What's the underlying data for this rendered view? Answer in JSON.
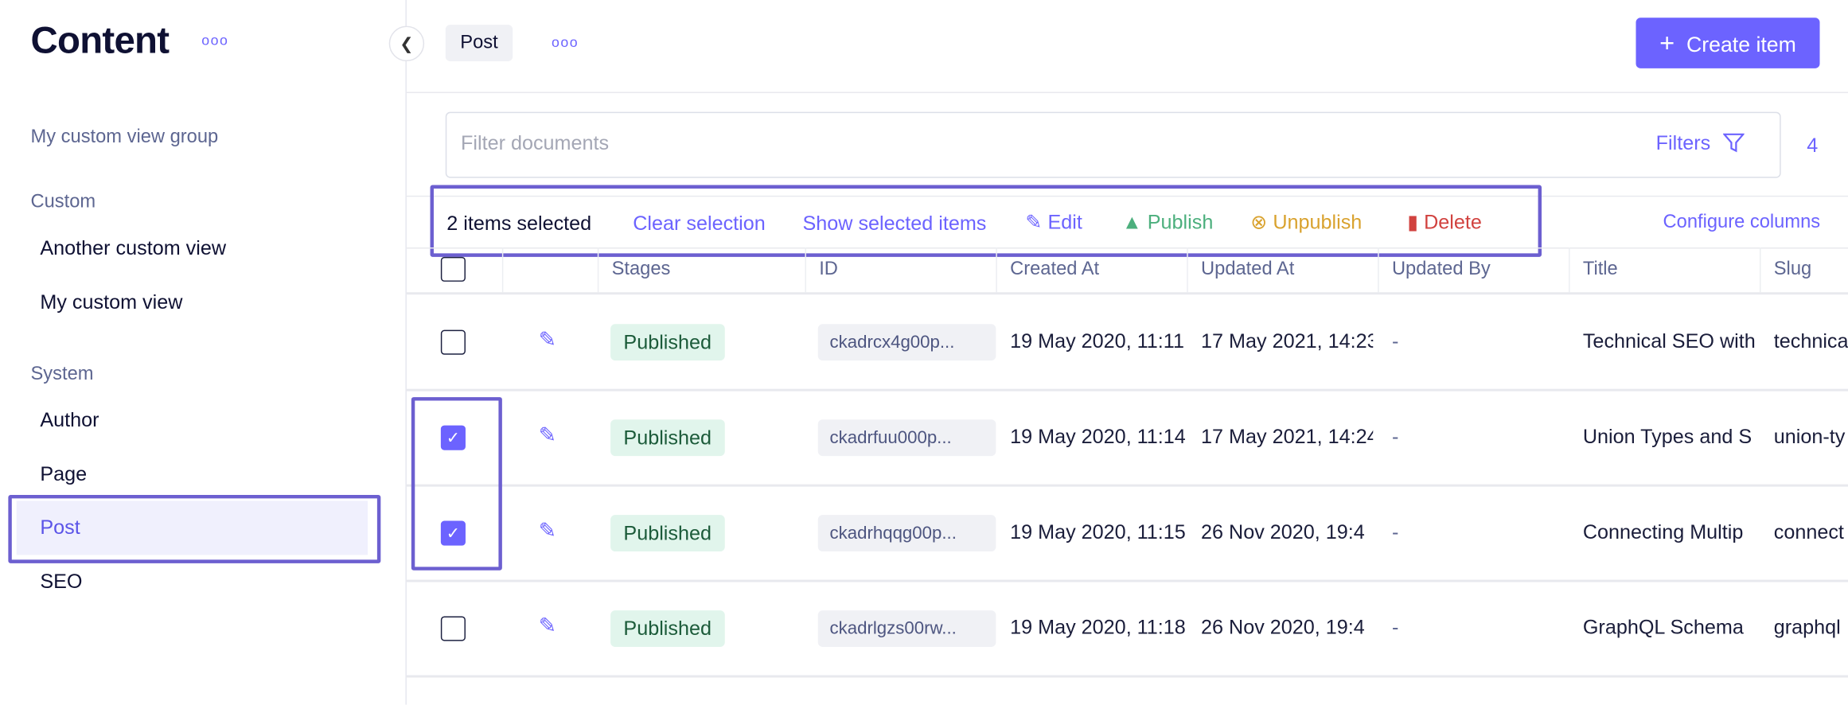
{
  "sidebar": {
    "title": "Content",
    "group_label": "My custom view group",
    "sections": [
      {
        "label": "Custom",
        "items": [
          "Another custom view",
          "My custom view"
        ]
      },
      {
        "label": "System",
        "items": [
          "Author",
          "Page",
          "Post",
          "SEO"
        ]
      }
    ],
    "active_item": "Post"
  },
  "header": {
    "model_chip": "Post",
    "create_label": "Create item",
    "create_icon": "plus-icon"
  },
  "filter": {
    "placeholder": "Filter documents",
    "filters_label": "Filters",
    "count": "4"
  },
  "actions": {
    "selected_text": "2 items selected",
    "clear": "Clear selection",
    "show_selected": "Show selected items",
    "edit": "Edit",
    "publish": "Publish",
    "unpublish": "Unpublish",
    "delete": "Delete",
    "configure": "Configure columns"
  },
  "colors": {
    "accent": "#6c63ff",
    "publish": "#4caf7d",
    "unpublish": "#d9a22e",
    "delete": "#d1423f"
  },
  "table": {
    "headers": [
      "Stages",
      "ID",
      "Created At",
      "Updated At",
      "Updated By",
      "Title",
      "Slug"
    ],
    "rows": [
      {
        "checked": false,
        "stage": "Published",
        "id": "ckadrcx4g00p...",
        "created": "19 May 2020, 11:11",
        "updated": "17 May 2021, 14:23",
        "updated_by": "-",
        "title": "Technical SEO with",
        "slug": "technical"
      },
      {
        "checked": true,
        "stage": "Published",
        "id": "ckadrfuu000p...",
        "created": "19 May 2020, 11:14",
        "updated": "17 May 2021, 14:24",
        "updated_by": "-",
        "title": "Union Types and S",
        "slug": "union-ty"
      },
      {
        "checked": true,
        "stage": "Published",
        "id": "ckadrhqqg00p...",
        "created": "19 May 2020, 11:15",
        "updated": "26 Nov 2020, 19:4",
        "updated_by": "-",
        "title": "Connecting Multip",
        "slug": "connect"
      },
      {
        "checked": false,
        "stage": "Published",
        "id": "ckadrlgzs00rw...",
        "created": "19 May 2020, 11:18",
        "updated": "26 Nov 2020, 19:4",
        "updated_by": "-",
        "title": "GraphQL Schema",
        "slug": "graphql"
      }
    ]
  }
}
